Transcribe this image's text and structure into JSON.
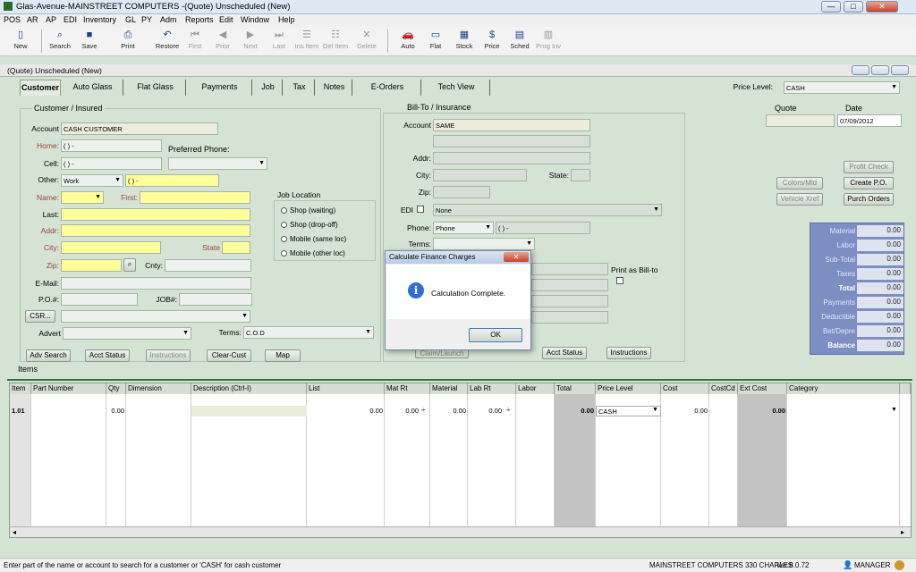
{
  "window": {
    "title": "Glas-Avenue-MAINSTREET COMPUTERS -(Quote) Unscheduled (New)",
    "minimize": "—",
    "maximize": "□",
    "close": "✕"
  },
  "menu": [
    "POS",
    "AR",
    "AP",
    "EDI",
    "Inventory",
    "GL",
    "PY",
    "Adm",
    "Reports",
    "Edit",
    "Window",
    "Help"
  ],
  "toolbar": {
    "new": "New",
    "search": "Search",
    "save": "Save",
    "print": "Print",
    "restore": "Restore",
    "first": "First",
    "prior": "Prior",
    "next": "Next",
    "last": "Last",
    "ins_item": "Ins Item",
    "del_item": "Del Item",
    "delete": "Delete",
    "auto": "Auto",
    "flat": "Flat",
    "stock": "Stock",
    "price": "Price",
    "sched": "Sched",
    "prog_inv": "Prog Inv"
  },
  "subwindow": {
    "title": "(Quote) Unscheduled (New)"
  },
  "tabs": [
    "Customer",
    "Auto Glass",
    "Flat Glass",
    "Payments",
    "Job",
    "Tax",
    "Notes",
    "E-Orders",
    "Tech View"
  ],
  "price_level": {
    "label": "Price Level:",
    "value": "CASH"
  },
  "quote": {
    "label": "Quote",
    "value": ""
  },
  "date": {
    "label": "Date",
    "value": "07/09/2012"
  },
  "customer": {
    "section": "Customer / Insured",
    "account_label": "Account",
    "account": "CASH CUSTOMER",
    "home_label": "Home:",
    "home": "( )  -",
    "cell_label": "Cell:",
    "cell": "( )  -",
    "preferred_phone": "Preferred Phone:",
    "other_label": "Other:",
    "other_type": "Work",
    "other": "( )  -",
    "name_label": "Name:",
    "first_label": "First:",
    "last_label": "Last:",
    "addr_label": "Addr:",
    "city_label": "City:",
    "state_label": "State",
    "zip_label": "Zip:",
    "cnty_label": "Cnty:",
    "email_label": "E-Mail:",
    "po_label": "P.O.#:",
    "job_label": "JOB#:",
    "csr": "CSR...",
    "advert_label": "Advert",
    "terms_label": "Terms:",
    "terms": "C.O.D"
  },
  "job_location": {
    "label": "Job Location",
    "options": [
      "Shop (waiting)",
      "Shop (drop-off)",
      "Mobile (same loc)",
      "Mobile (other loc)"
    ]
  },
  "billto": {
    "section": "Bill-To / Insurance",
    "account_label": "Account",
    "account": "SAME",
    "addr_label": "Addr:",
    "city_label": "City:",
    "state_label": "State:",
    "zip_label": "Zip:",
    "edi_label": "EDI",
    "edi": "None",
    "phone_label": "Phone:",
    "phone_type": "Phone",
    "phone": "( )  -",
    "terms_label": "Terms:",
    "print_as_billto": "Print as Bill-to"
  },
  "buttons": {
    "adv_search": "Adv Search",
    "acct_status": "Acct Status",
    "instructions": "Instructions",
    "clear_cust": "Clear-Cust",
    "map": "Map",
    "claim_launch": "Claim/Launch",
    "acct_status2": "Acct Status",
    "instructions2": "Instructions",
    "profit_check": "Profit Check",
    "colors_mld": "Colors/Mld",
    "create_po": "Create P.O.",
    "vehicle_xref": "Vehicle Xref",
    "purch_orders": "Purch Orders"
  },
  "totals": [
    {
      "label": "Material",
      "value": "0.00"
    },
    {
      "label": "Labor",
      "value": "0.00"
    },
    {
      "label": "Sub-Total",
      "value": "0.00"
    },
    {
      "label": "Taxes",
      "value": "0.00"
    },
    {
      "label": "Total",
      "value": "0.00"
    },
    {
      "label": "Payments",
      "value": "0.00"
    },
    {
      "label": "Deductible",
      "value": "0.00"
    },
    {
      "label": "Bet/Depre",
      "value": "0.00"
    },
    {
      "label": "Balance",
      "value": "0.00"
    }
  ],
  "items_label": "Items",
  "grid": {
    "headers": [
      "Item",
      "Part Number",
      "Qty",
      "Dimension",
      "Description (Ctrl-I)",
      "List",
      "Mat Rt",
      "Material",
      "Lab Rt",
      "Labor",
      "Total",
      "Price Level",
      "Cost",
      "CostCd",
      "Ext Cost",
      "Category"
    ],
    "row": {
      "item": "1.01",
      "qty": "0.00",
      "list": "0.00",
      "mat_rt": "0.00",
      "material": "0.00",
      "lab_rt": "0.00",
      "total": "0.00",
      "price_level": "CASH",
      "cost": "0.00",
      "ext_cost": "0.00"
    }
  },
  "dialog": {
    "title": "Calculate Finance Charges",
    "message": "Calculation Complete.",
    "ok": "OK",
    "close": "✕"
  },
  "status": {
    "hint": "Enter part of the name or account to search for a customer or 'CASH' for cash customer",
    "company": "MAINSTREET COMPUTERS 330 CHARLES",
    "version": "Ver:8.0.72",
    "user": "MANAGER"
  }
}
